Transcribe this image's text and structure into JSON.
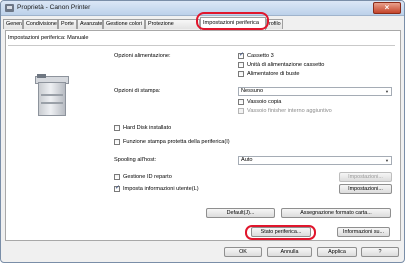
{
  "window": {
    "title": "Proprietà - Canon Printer",
    "close_icon": "×"
  },
  "tabs": [
    {
      "label": "Generale"
    },
    {
      "label": "Condivisione"
    },
    {
      "label": "Porte"
    },
    {
      "label": "Avanzate"
    },
    {
      "label": "Gestione colori"
    },
    {
      "label": "Protezione"
    },
    {
      "label": "Impostazioni periferica"
    },
    {
      "label": "rofilo"
    }
  ],
  "panel": {
    "header": "Impostazioni periferica: Manuale",
    "paper_source_label": "Opzioni alimentazione:",
    "paper_source_options": [
      {
        "label": "Cassetto 3",
        "checked": true
      },
      {
        "label": "Unità di alimentazione cassetto",
        "checked": false
      },
      {
        "label": "Alimentatore di buste",
        "checked": false
      }
    ],
    "output_label": "Opzioni di stampa:",
    "output_value": "Nessuno",
    "output_options": [
      {
        "label": "Vassoio copia",
        "checked": false
      },
      {
        "label": "Vassoio finisher interno aggiuntivo",
        "checked": false
      }
    ],
    "hdd_label": "Hard Disk installato",
    "secure_print_label": "Funzione stampa protetta della periferica(I)",
    "spooling_label": "Spooling all'host:",
    "spooling_value": "Auto",
    "dept_id_label": "Gestione ID reparto",
    "dept_id_settings": "Impostazioni...",
    "user_info_label": "Imposta informazioni utente(L)",
    "user_info_settings": "Impostazioni...",
    "defaults_button": "Default(J)...",
    "form_assign_button": "Assegnazione formato carta...",
    "device_status_button": "Stato periferica...",
    "about_button": "Informazioni su..."
  },
  "footer": {
    "ok": "OK",
    "cancel": "Annulla",
    "apply": "Applica",
    "help": "?"
  },
  "colors": {
    "highlight_ring": "#e0162c",
    "accent_check": "#1d3b7a"
  }
}
